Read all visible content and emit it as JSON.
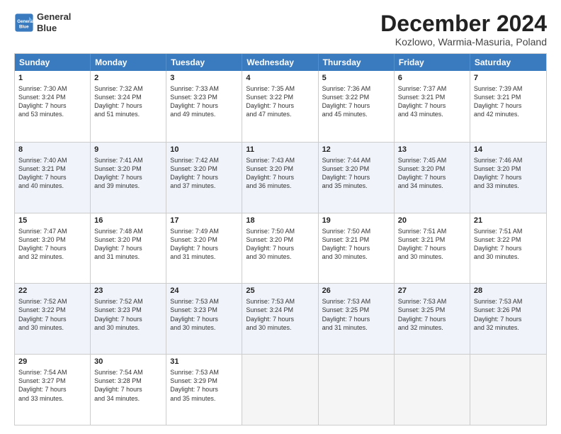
{
  "header": {
    "logo_line1": "General",
    "logo_line2": "Blue",
    "title": "December 2024",
    "subtitle": "Kozlowo, Warmia-Masuria, Poland"
  },
  "days": [
    "Sunday",
    "Monday",
    "Tuesday",
    "Wednesday",
    "Thursday",
    "Friday",
    "Saturday"
  ],
  "weeks": [
    [
      {
        "num": "1",
        "lines": [
          "Sunrise: 7:30 AM",
          "Sunset: 3:24 PM",
          "Daylight: 7 hours",
          "and 53 minutes."
        ]
      },
      {
        "num": "2",
        "lines": [
          "Sunrise: 7:32 AM",
          "Sunset: 3:24 PM",
          "Daylight: 7 hours",
          "and 51 minutes."
        ]
      },
      {
        "num": "3",
        "lines": [
          "Sunrise: 7:33 AM",
          "Sunset: 3:23 PM",
          "Daylight: 7 hours",
          "and 49 minutes."
        ]
      },
      {
        "num": "4",
        "lines": [
          "Sunrise: 7:35 AM",
          "Sunset: 3:22 PM",
          "Daylight: 7 hours",
          "and 47 minutes."
        ]
      },
      {
        "num": "5",
        "lines": [
          "Sunrise: 7:36 AM",
          "Sunset: 3:22 PM",
          "Daylight: 7 hours",
          "and 45 minutes."
        ]
      },
      {
        "num": "6",
        "lines": [
          "Sunrise: 7:37 AM",
          "Sunset: 3:21 PM",
          "Daylight: 7 hours",
          "and 43 minutes."
        ]
      },
      {
        "num": "7",
        "lines": [
          "Sunrise: 7:39 AM",
          "Sunset: 3:21 PM",
          "Daylight: 7 hours",
          "and 42 minutes."
        ]
      }
    ],
    [
      {
        "num": "8",
        "lines": [
          "Sunrise: 7:40 AM",
          "Sunset: 3:21 PM",
          "Daylight: 7 hours",
          "and 40 minutes."
        ]
      },
      {
        "num": "9",
        "lines": [
          "Sunrise: 7:41 AM",
          "Sunset: 3:20 PM",
          "Daylight: 7 hours",
          "and 39 minutes."
        ]
      },
      {
        "num": "10",
        "lines": [
          "Sunrise: 7:42 AM",
          "Sunset: 3:20 PM",
          "Daylight: 7 hours",
          "and 37 minutes."
        ]
      },
      {
        "num": "11",
        "lines": [
          "Sunrise: 7:43 AM",
          "Sunset: 3:20 PM",
          "Daylight: 7 hours",
          "and 36 minutes."
        ]
      },
      {
        "num": "12",
        "lines": [
          "Sunrise: 7:44 AM",
          "Sunset: 3:20 PM",
          "Daylight: 7 hours",
          "and 35 minutes."
        ]
      },
      {
        "num": "13",
        "lines": [
          "Sunrise: 7:45 AM",
          "Sunset: 3:20 PM",
          "Daylight: 7 hours",
          "and 34 minutes."
        ]
      },
      {
        "num": "14",
        "lines": [
          "Sunrise: 7:46 AM",
          "Sunset: 3:20 PM",
          "Daylight: 7 hours",
          "and 33 minutes."
        ]
      }
    ],
    [
      {
        "num": "15",
        "lines": [
          "Sunrise: 7:47 AM",
          "Sunset: 3:20 PM",
          "Daylight: 7 hours",
          "and 32 minutes."
        ]
      },
      {
        "num": "16",
        "lines": [
          "Sunrise: 7:48 AM",
          "Sunset: 3:20 PM",
          "Daylight: 7 hours",
          "and 31 minutes."
        ]
      },
      {
        "num": "17",
        "lines": [
          "Sunrise: 7:49 AM",
          "Sunset: 3:20 PM",
          "Daylight: 7 hours",
          "and 31 minutes."
        ]
      },
      {
        "num": "18",
        "lines": [
          "Sunrise: 7:50 AM",
          "Sunset: 3:20 PM",
          "Daylight: 7 hours",
          "and 30 minutes."
        ]
      },
      {
        "num": "19",
        "lines": [
          "Sunrise: 7:50 AM",
          "Sunset: 3:21 PM",
          "Daylight: 7 hours",
          "and 30 minutes."
        ]
      },
      {
        "num": "20",
        "lines": [
          "Sunrise: 7:51 AM",
          "Sunset: 3:21 PM",
          "Daylight: 7 hours",
          "and 30 minutes."
        ]
      },
      {
        "num": "21",
        "lines": [
          "Sunrise: 7:51 AM",
          "Sunset: 3:22 PM",
          "Daylight: 7 hours",
          "and 30 minutes."
        ]
      }
    ],
    [
      {
        "num": "22",
        "lines": [
          "Sunrise: 7:52 AM",
          "Sunset: 3:22 PM",
          "Daylight: 7 hours",
          "and 30 minutes."
        ]
      },
      {
        "num": "23",
        "lines": [
          "Sunrise: 7:52 AM",
          "Sunset: 3:23 PM",
          "Daylight: 7 hours",
          "and 30 minutes."
        ]
      },
      {
        "num": "24",
        "lines": [
          "Sunrise: 7:53 AM",
          "Sunset: 3:23 PM",
          "Daylight: 7 hours",
          "and 30 minutes."
        ]
      },
      {
        "num": "25",
        "lines": [
          "Sunrise: 7:53 AM",
          "Sunset: 3:24 PM",
          "Daylight: 7 hours",
          "and 30 minutes."
        ]
      },
      {
        "num": "26",
        "lines": [
          "Sunrise: 7:53 AM",
          "Sunset: 3:25 PM",
          "Daylight: 7 hours",
          "and 31 minutes."
        ]
      },
      {
        "num": "27",
        "lines": [
          "Sunrise: 7:53 AM",
          "Sunset: 3:25 PM",
          "Daylight: 7 hours",
          "and 32 minutes."
        ]
      },
      {
        "num": "28",
        "lines": [
          "Sunrise: 7:53 AM",
          "Sunset: 3:26 PM",
          "Daylight: 7 hours",
          "and 32 minutes."
        ]
      }
    ],
    [
      {
        "num": "29",
        "lines": [
          "Sunrise: 7:54 AM",
          "Sunset: 3:27 PM",
          "Daylight: 7 hours",
          "and 33 minutes."
        ]
      },
      {
        "num": "30",
        "lines": [
          "Sunrise: 7:54 AM",
          "Sunset: 3:28 PM",
          "Daylight: 7 hours",
          "and 34 minutes."
        ]
      },
      {
        "num": "31",
        "lines": [
          "Sunrise: 7:53 AM",
          "Sunset: 3:29 PM",
          "Daylight: 7 hours",
          "and 35 minutes."
        ]
      },
      null,
      null,
      null,
      null
    ]
  ]
}
